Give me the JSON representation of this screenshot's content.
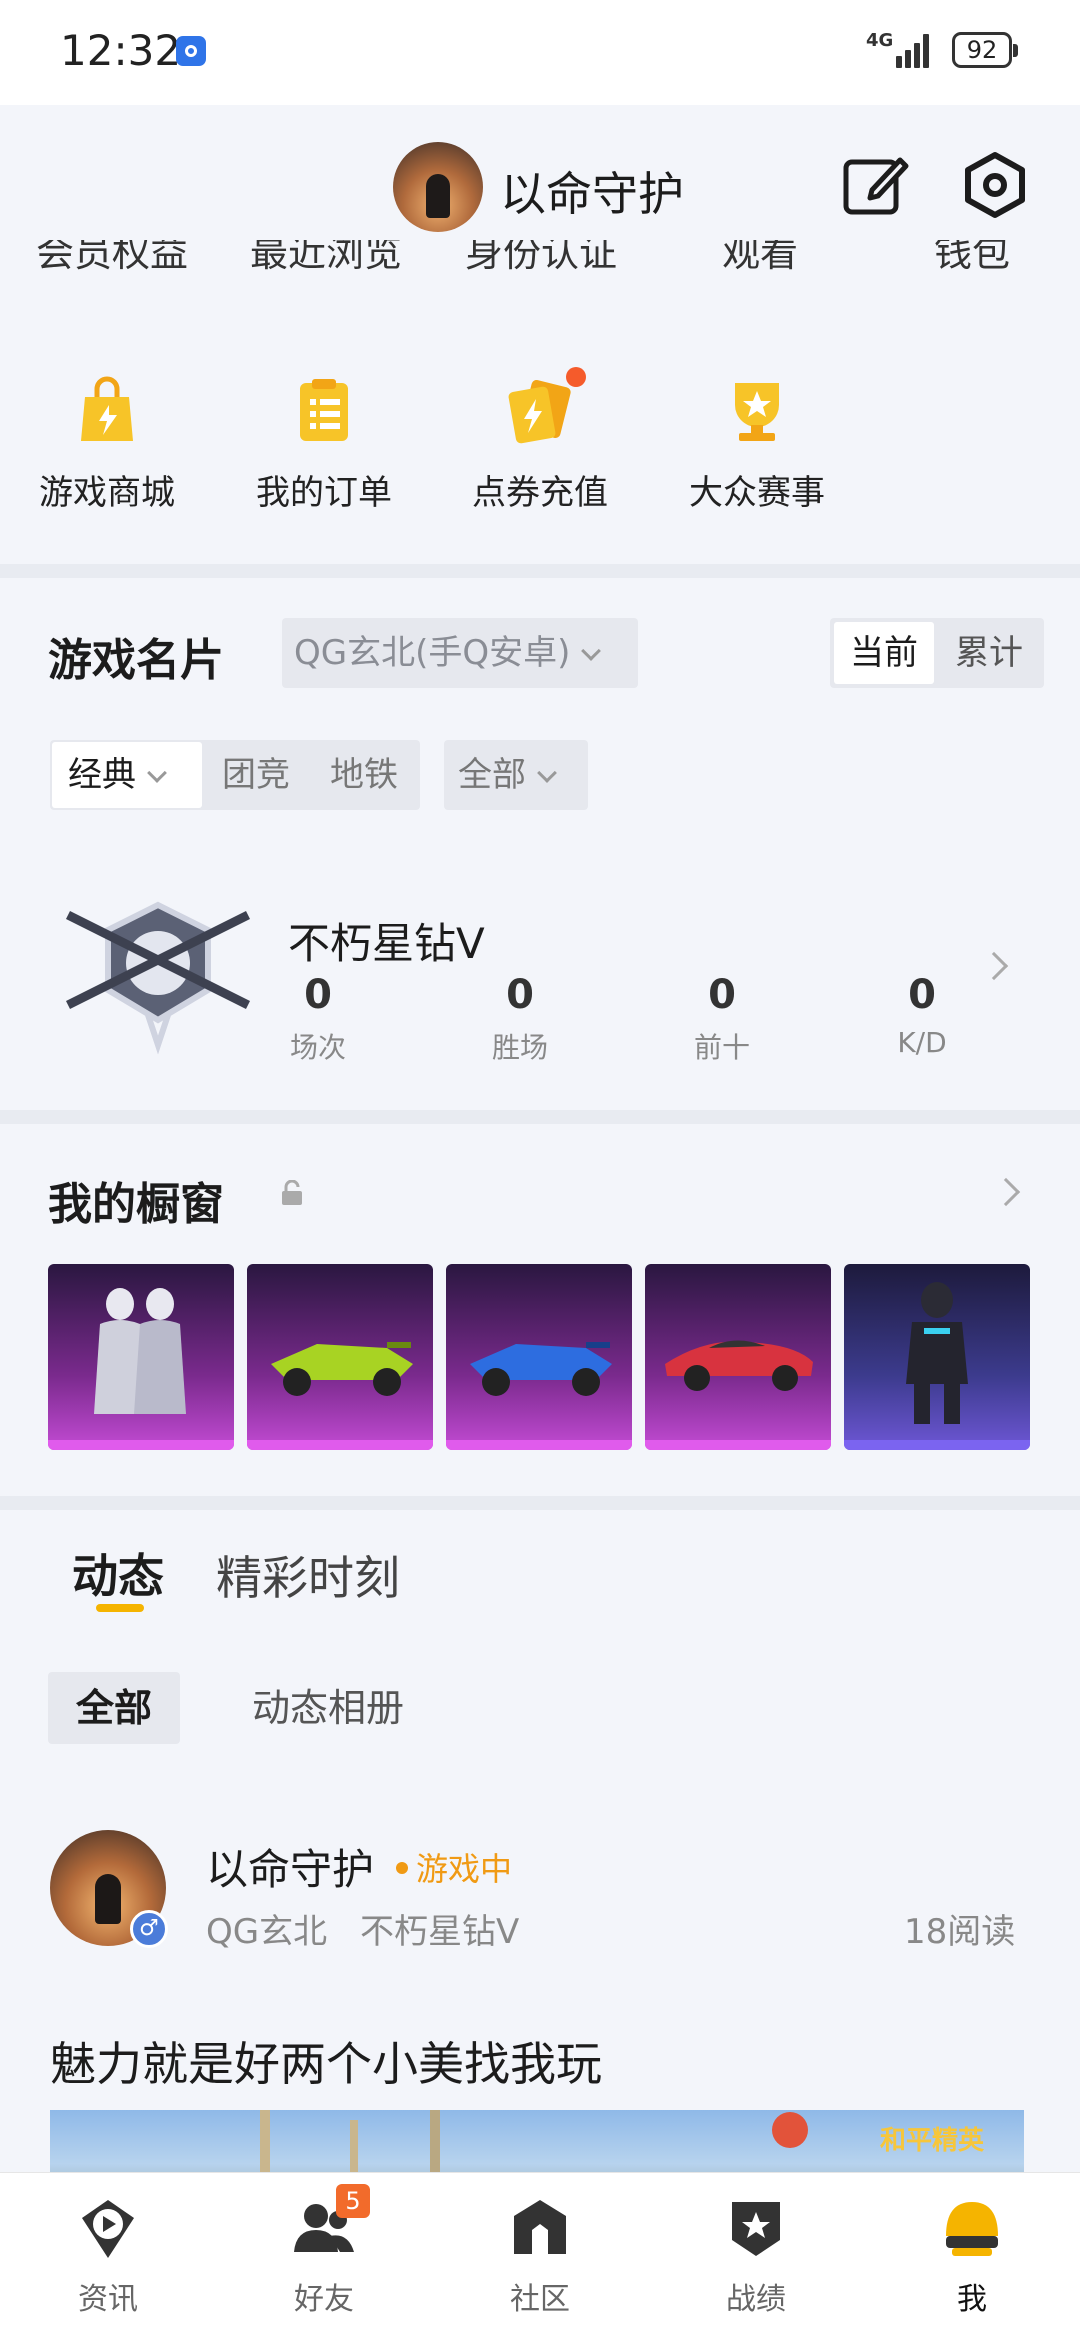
{
  "status_bar": {
    "time": "12:32",
    "network": "4G",
    "battery": "92"
  },
  "profile": {
    "name": "以命守护"
  },
  "clipped_row": [
    "会员权益",
    "最近浏览",
    "身份认证",
    "观看",
    "钱包"
  ],
  "quick_menu": [
    {
      "label": "游戏商城",
      "icon": "shopping-bag-icon"
    },
    {
      "label": "我的订单",
      "icon": "order-list-icon"
    },
    {
      "label": "点券充值",
      "icon": "coupon-recharge-icon",
      "has_dot": true
    },
    {
      "label": "大众赛事",
      "icon": "trophy-icon"
    }
  ],
  "game_card": {
    "title": "游戏名片",
    "server": "QG玄北(手Q安卓)",
    "toggle": {
      "current": "当前",
      "cumulative": "累计"
    },
    "modes": {
      "classic": "经典",
      "team": "团竞",
      "metro": "地铁",
      "all": "全部"
    },
    "rank": "不朽星钻V",
    "stats": [
      {
        "value": "0",
        "label": "场次"
      },
      {
        "value": "0",
        "label": "胜场"
      },
      {
        "value": "0",
        "label": "前十"
      },
      {
        "value": "0",
        "label": "K/D"
      }
    ]
  },
  "showcase": {
    "title": "我的橱窗"
  },
  "feed": {
    "tabs": {
      "active": "动态",
      "other": "精彩时刻"
    },
    "chips": {
      "all": "全部",
      "album": "动态相册"
    },
    "post": {
      "author": "以命守护",
      "status": "游戏中",
      "server": "QG玄北",
      "rank": "不朽星钻V",
      "reads": "18阅读",
      "text": "魅力就是好两个小美找我玩",
      "image_logo": "和平精英"
    }
  },
  "bottom_nav": [
    {
      "label": "资讯",
      "icon": "news-play-icon"
    },
    {
      "label": "好友",
      "icon": "friends-icon",
      "badge": "5"
    },
    {
      "label": "社区",
      "icon": "community-icon"
    },
    {
      "label": "战绩",
      "icon": "record-shield-icon"
    },
    {
      "label": "我",
      "icon": "me-helmet-icon",
      "active": true
    }
  ],
  "colors": {
    "accent": "#f5b400",
    "badge": "#f26b2b",
    "ingame": "#f09a14"
  }
}
